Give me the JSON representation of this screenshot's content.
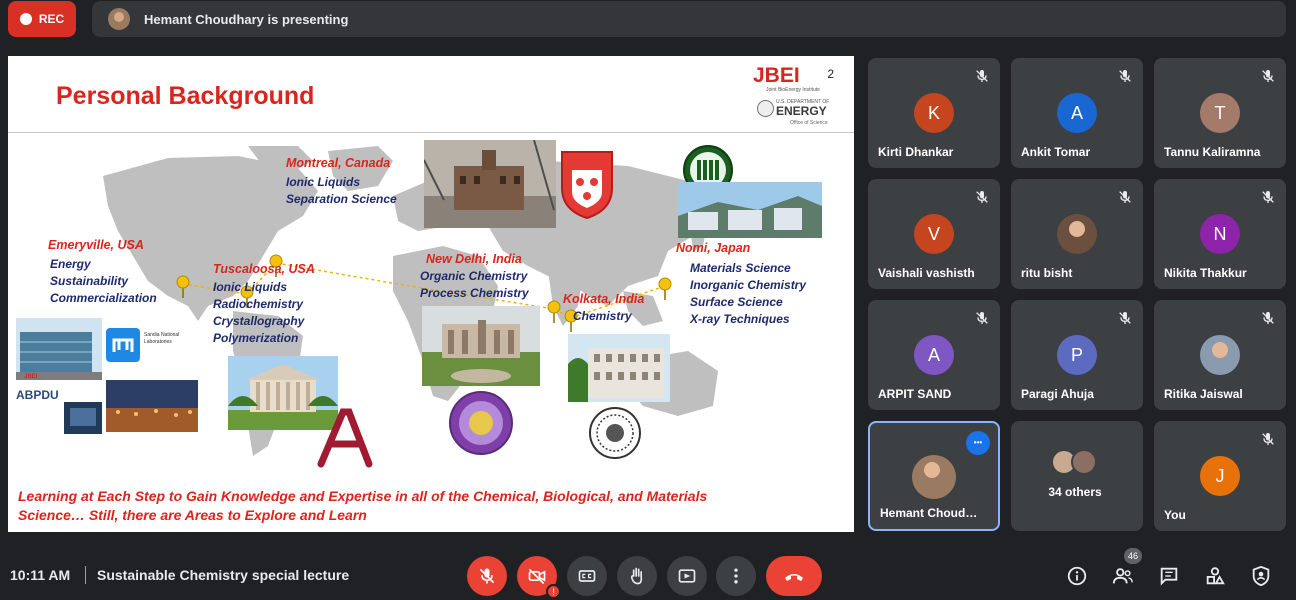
{
  "topbar": {
    "rec_label": "REC",
    "presenting_text": "Hemant Choudhary is presenting"
  },
  "slide": {
    "title": "Personal Background",
    "page_number": "2",
    "logos": {
      "jbei": "JBEI",
      "jbei_sub": "Joint BioEnergy Institute",
      "doe_small": "U.S. DEPARTMENT OF",
      "doe": "ENERGY",
      "doe_office": "Office of Science",
      "sandia": "Sandia National Laboratories",
      "abpdu": "ABPDU",
      "jbei_small": "JBEI"
    },
    "locations": [
      {
        "city": "Emeryville, USA",
        "items": [
          "Energy",
          "Sustainability",
          "Commercialization"
        ]
      },
      {
        "city": "Tuscaloosa, USA",
        "items": [
          "Ionic Liquids",
          "Radiochemistry",
          "Crystallography",
          "Polymerization"
        ]
      },
      {
        "city": "Montreal, Canada",
        "items": [
          "Ionic Liquids",
          "Separation Science"
        ]
      },
      {
        "city": "New Delhi, India",
        "items": [
          "Organic Chemistry",
          "Process Chemistry"
        ]
      },
      {
        "city": "Kolkata, India",
        "items": [
          "Chemistry"
        ]
      },
      {
        "city": "Nomi, Japan",
        "items": [
          "Materials Science",
          "Inorganic Chemistry",
          "Surface Science",
          "X-ray Techniques"
        ]
      }
    ],
    "footer_line1": "Learning at Each Step to Gain Knowledge and Expertise in all of the Chemical, Biological, and Materials",
    "footer_line2": "Science… Still, there are Areas to Explore and Learn",
    "colors": {
      "title": "#d8251d",
      "items": "#1f2a6b"
    }
  },
  "participants": [
    {
      "initial": "K",
      "name": "Kirti Dhankar",
      "color": "#c5451f",
      "muted": true
    },
    {
      "initial": "A",
      "name": "Ankit Tomar",
      "color": "#1967d2",
      "muted": true
    },
    {
      "initial": "T",
      "name": "Tannu Kaliramna",
      "color": "#a47b6b",
      "muted": true
    },
    {
      "initial": "V",
      "name": "Vaishali vashisth",
      "color": "#c5451f",
      "muted": true
    },
    {
      "initial": "",
      "name": "ritu bisht",
      "color": "#6b4f3f",
      "muted": true
    },
    {
      "initial": "N",
      "name": "Nikita Thakkur",
      "color": "#8e24aa",
      "muted": true
    },
    {
      "initial": "A",
      "name": "ARPIT SAND",
      "color": "#7e57c2",
      "muted": true
    },
    {
      "initial": "P",
      "name": "Paragi Ahuja",
      "color": "#5c6bc0",
      "muted": true
    },
    {
      "initial": "",
      "name": "Ritika Jaiswal",
      "color": "#8a9bb0",
      "muted": true
    },
    {
      "initial": "",
      "name": "Hemant Choud…",
      "color": "#9a7b62",
      "muted": false
    },
    {
      "initial": "",
      "name": "34 others",
      "color": "#5f6368",
      "muted": false
    },
    {
      "initial": "J",
      "name": "You",
      "color": "#e8710a",
      "muted": true
    }
  ],
  "bottombar": {
    "time": "10:11 AM",
    "meeting_title": "Sustainable Chemistry special lecture",
    "camera_badge": "!",
    "people_count": "46"
  },
  "icons": [
    "mic-off-icon",
    "camera-off-icon",
    "captions-icon",
    "raise-hand-icon",
    "present-icon",
    "more-icon",
    "hangup-icon",
    "info-icon",
    "people-icon",
    "chat-icon",
    "activities-icon",
    "host-controls-icon"
  ]
}
